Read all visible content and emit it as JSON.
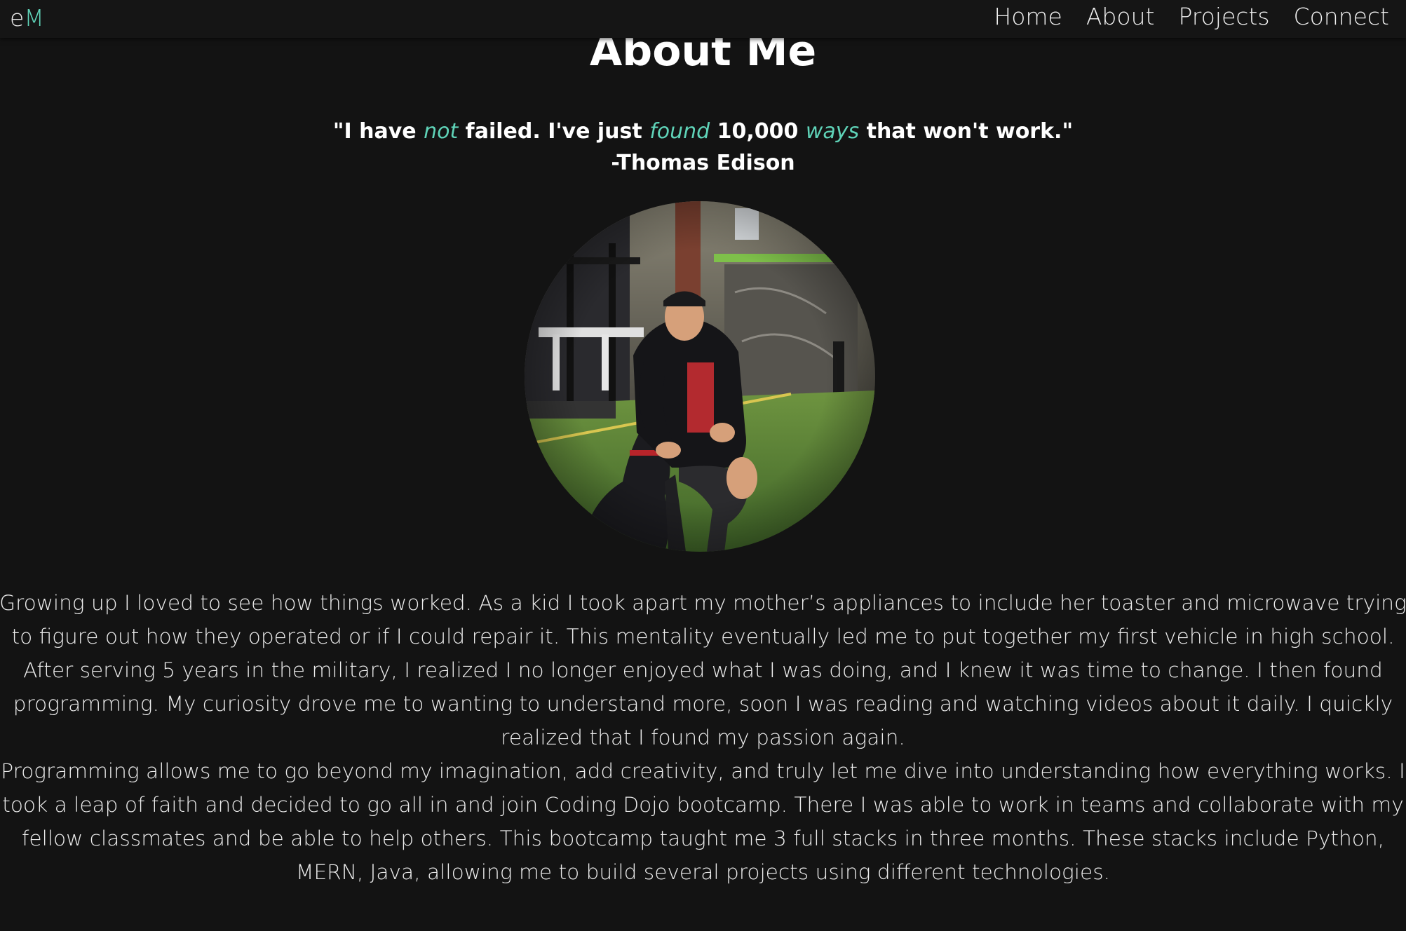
{
  "nav": {
    "brand_prefix": "e",
    "brand_accent": "M",
    "links": [
      {
        "label": "Home"
      },
      {
        "label": "About"
      },
      {
        "label": "Projects"
      },
      {
        "label": "Connect"
      }
    ]
  },
  "page": {
    "title": "About Me"
  },
  "quote": {
    "part1": "\"I have ",
    "em1": "not",
    "part2": " failed. I've just ",
    "em2": "found",
    "part3": " 10,000 ",
    "em3": "ways",
    "part4": " that won't work.\"",
    "author": "-Thomas Edison"
  },
  "bio": {
    "paragraph1": "Growing up I loved to see how things worked. As a kid I took apart my mother’s appliances to include her toaster and microwave trying to figure out how they operated or if I could repair it. This mentality eventually led me to put together my first vehicle in high school. After serving 5 years in the military, I realized I no longer enjoyed what I was doing, and I knew it was time to change. I then found programming. My curiosity drove me to wanting to understand more, soon I was reading and watching videos about it daily. I quickly realized that I found my passion again.",
    "paragraph2": "Programming allows me to go beyond my imagination, add creativity, and truly let me dive into understanding how everything works. I took a leap of faith and decided to go all in and join Coding Dojo bootcamp. There I was able to work in teams and collaborate with my fellow classmates and be able to help others. This bootcamp taught me 3 full stacks in three months. These stacks include Python, MERN, Java, allowing me to build several projects using different technologies."
  },
  "colors": {
    "background": "#131313",
    "accent": "#5fd3b8",
    "text": "#ececec"
  }
}
